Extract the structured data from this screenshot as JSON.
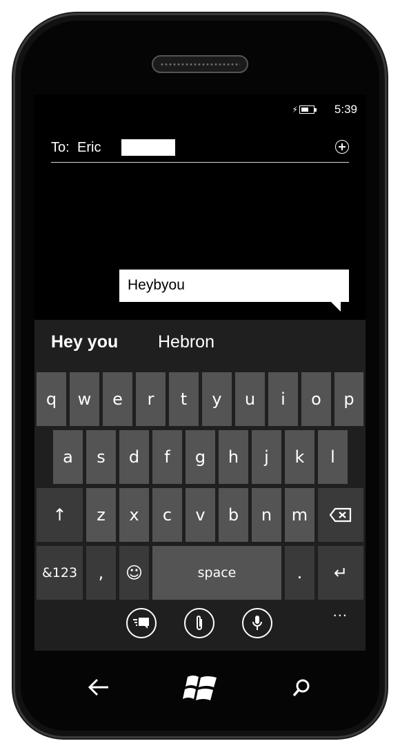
{
  "status": {
    "time": "5:39"
  },
  "compose": {
    "to_label": "To:",
    "recipient_name": "Eric",
    "message_text": "Heybyou"
  },
  "suggestions": [
    "Hey you",
    "Hebron"
  ],
  "keyboard": {
    "row1": [
      "q",
      "w",
      "e",
      "r",
      "t",
      "y",
      "u",
      "i",
      "o",
      "p"
    ],
    "row2": [
      "a",
      "s",
      "d",
      "f",
      "g",
      "h",
      "j",
      "k",
      "l"
    ],
    "row3": [
      "z",
      "x",
      "c",
      "v",
      "b",
      "n",
      "m"
    ],
    "shift_symbol": "↑",
    "symbols_label": "&123",
    "comma_label": ",",
    "emoji_symbol": "☺",
    "space_label": "space",
    "period_label": ".",
    "enter_symbol": "↵",
    "more_label": "..."
  },
  "icons": {
    "add": "add-recipient-icon",
    "battery": "battery-charging-icon",
    "send": "send-icon",
    "attach": "attach-icon",
    "voice": "microphone-icon",
    "back": "back-icon",
    "windows": "windows-icon",
    "search": "search-icon"
  }
}
